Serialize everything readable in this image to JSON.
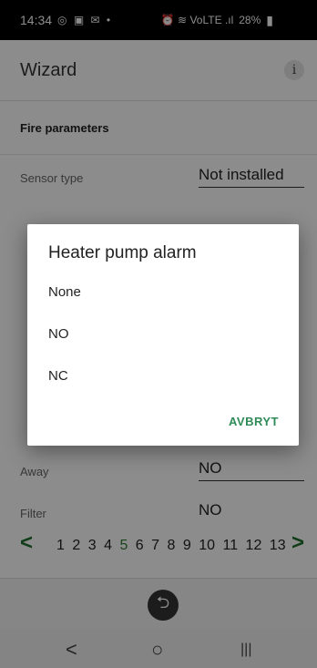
{
  "status_bar": {
    "time": "14:34",
    "icons_left": "◎ ▣ ✉ •",
    "icons_right": "⏰ ≋ VoLTE .ıl",
    "battery": "28%"
  },
  "app_bar": {
    "title": "Wizard",
    "info_icon": "i"
  },
  "section_fire": {
    "title": "Fire parameters"
  },
  "rows": [
    {
      "label": "Sensor type",
      "value": "Not installed"
    },
    {
      "label": "Away",
      "value": "NO"
    },
    {
      "label": "Filter",
      "value": "NO"
    }
  ],
  "pager": {
    "prev": "<",
    "next": ">",
    "pages": [
      "1",
      "2",
      "3",
      "4",
      "5",
      "6",
      "7",
      "8",
      "9",
      "10",
      "11",
      "12",
      "13"
    ],
    "active_page": "5"
  },
  "bottom": {
    "return_icon": "⮌"
  },
  "nav": {
    "back": "<",
    "home": "○",
    "recents": "|||"
  },
  "dialog": {
    "title": "Heater pump alarm",
    "options": [
      "None",
      "NO",
      "NC"
    ],
    "cancel": "AVBRYT"
  },
  "colors": {
    "accent_green": "#2e7d32",
    "cancel_green": "#2e8b57"
  }
}
